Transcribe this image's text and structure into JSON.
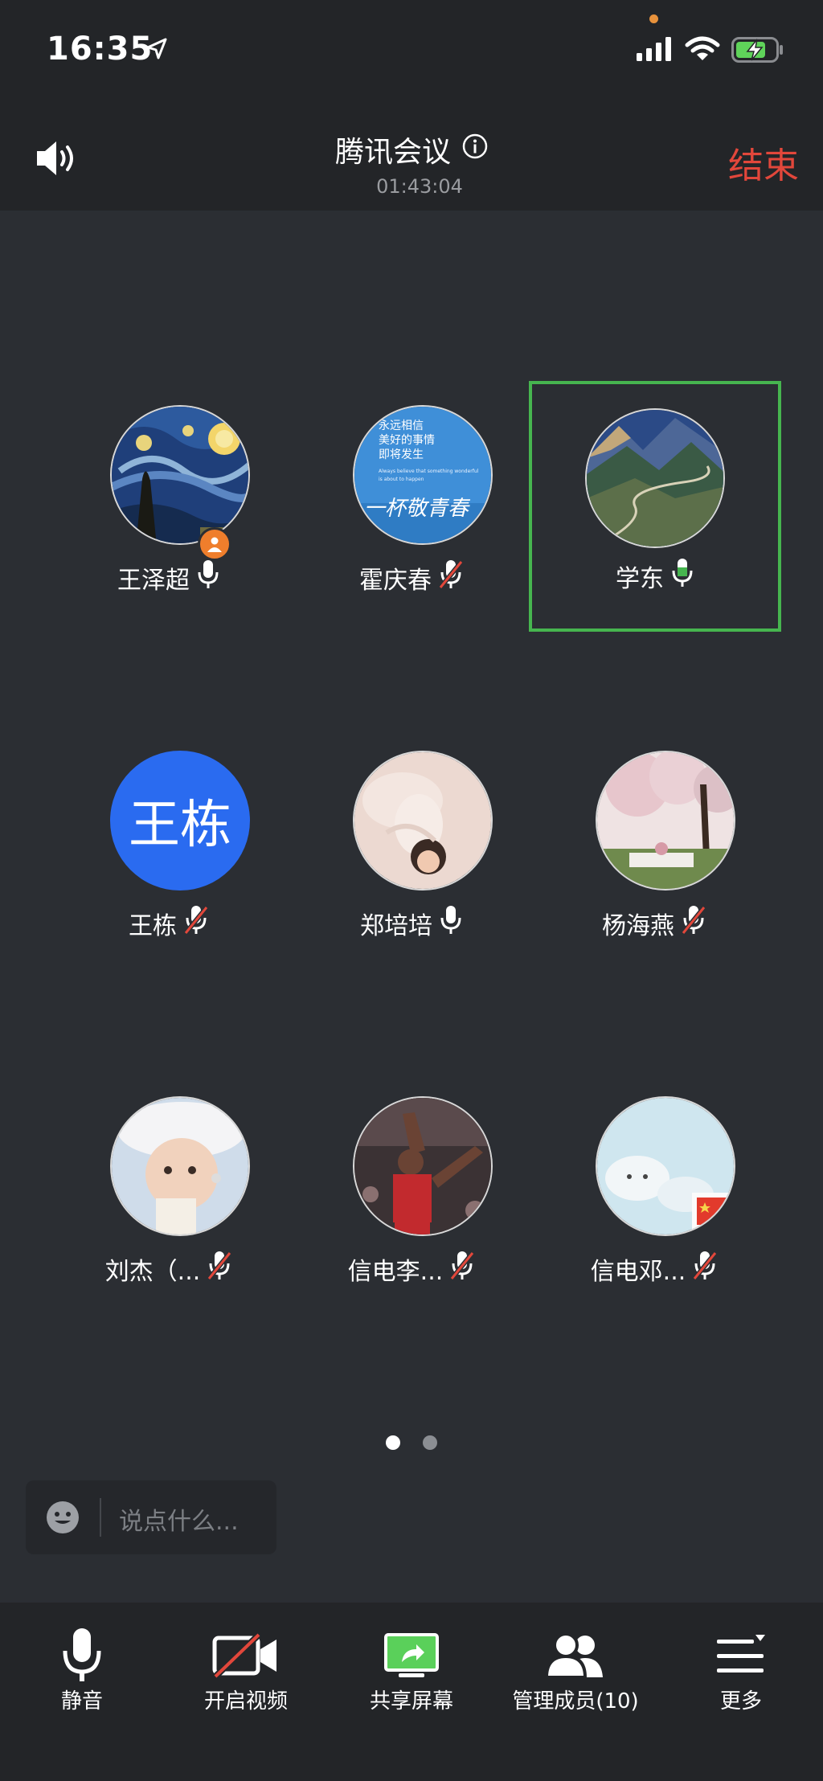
{
  "status_bar": {
    "time": "16:35"
  },
  "header": {
    "title": "腾讯会议",
    "timer": "01:43:04",
    "end_label": "结束"
  },
  "participants": [
    {
      "name": "王泽超",
      "mic": "on",
      "host": true
    },
    {
      "name": "霍庆春",
      "mic": "muted"
    },
    {
      "name": "学东",
      "mic": "speaking",
      "active": true
    },
    {
      "name": "王栋",
      "mic": "muted",
      "avatar_text": "王栋"
    },
    {
      "name": "郑培培",
      "mic": "on"
    },
    {
      "name": "杨海燕",
      "mic": "muted"
    },
    {
      "name": "刘杰（...",
      "mic": "muted"
    },
    {
      "name": "信电李...",
      "mic": "muted"
    },
    {
      "name": "信电邓...",
      "mic": "muted"
    }
  ],
  "avatar_texts": {
    "p2_line1": "永远相信",
    "p2_line2": "美好的事情",
    "p2_line3": "即将发生",
    "p2_line4": "Always believe that something wonderful",
    "p2_line5": "is about to happen",
    "p2_line6": "一杯敬青春"
  },
  "pagination": {
    "current": 1,
    "total": 2
  },
  "chat": {
    "placeholder": "说点什么..."
  },
  "toolbar": {
    "mute_label": "静音",
    "video_label": "开启视频",
    "share_label": "共享屏幕",
    "members_label": "管理成员(10)",
    "more_label": "更多"
  },
  "colors": {
    "background": "#2b2e33",
    "bar": "#232528",
    "end_red": "#e2473b",
    "speaking_green": "#46b54f",
    "avatar_blue": "#2a6bf0",
    "host_orange": "#ef7e2c"
  }
}
